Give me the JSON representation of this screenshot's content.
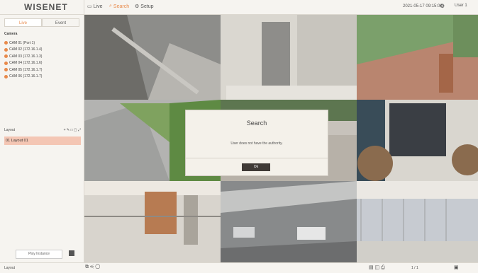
{
  "header": {
    "logo": "WISENET",
    "nav": [
      {
        "label": "Live",
        "icon": "monitor-icon"
      },
      {
        "label": "Search",
        "icon": "search-icon",
        "active": true
      },
      {
        "label": "Setup",
        "icon": "gear-icon"
      }
    ],
    "datetime": "2021-05-17 09:15:06",
    "user": "User 1"
  },
  "sidebar": {
    "tabs": [
      "Live",
      "Event"
    ],
    "camera_header": "Camera",
    "cameras": [
      "CAM 01 (Port 1)",
      "CAM 02 (172.16.1.4)",
      "CAM 03 (172.16.1.3)",
      "CAM 04 (172.16.1.6)",
      "CAM 05 (172.16.1.7)",
      "CAM 06 (172.16.1.7)"
    ],
    "layout_header": "Layout",
    "layout_item": "01 Layout 01",
    "play_button": "Play Instance"
  },
  "dialog": {
    "title": "Search",
    "message": "User does not have the authority.",
    "ok": "Ok"
  },
  "bottombar": {
    "left_label": "Layout",
    "right_label": "1 / 1"
  },
  "colors": {
    "accent": "#e8894a",
    "layout_highlight": "#f4c6b4",
    "ok_button": "#3f3a36"
  }
}
